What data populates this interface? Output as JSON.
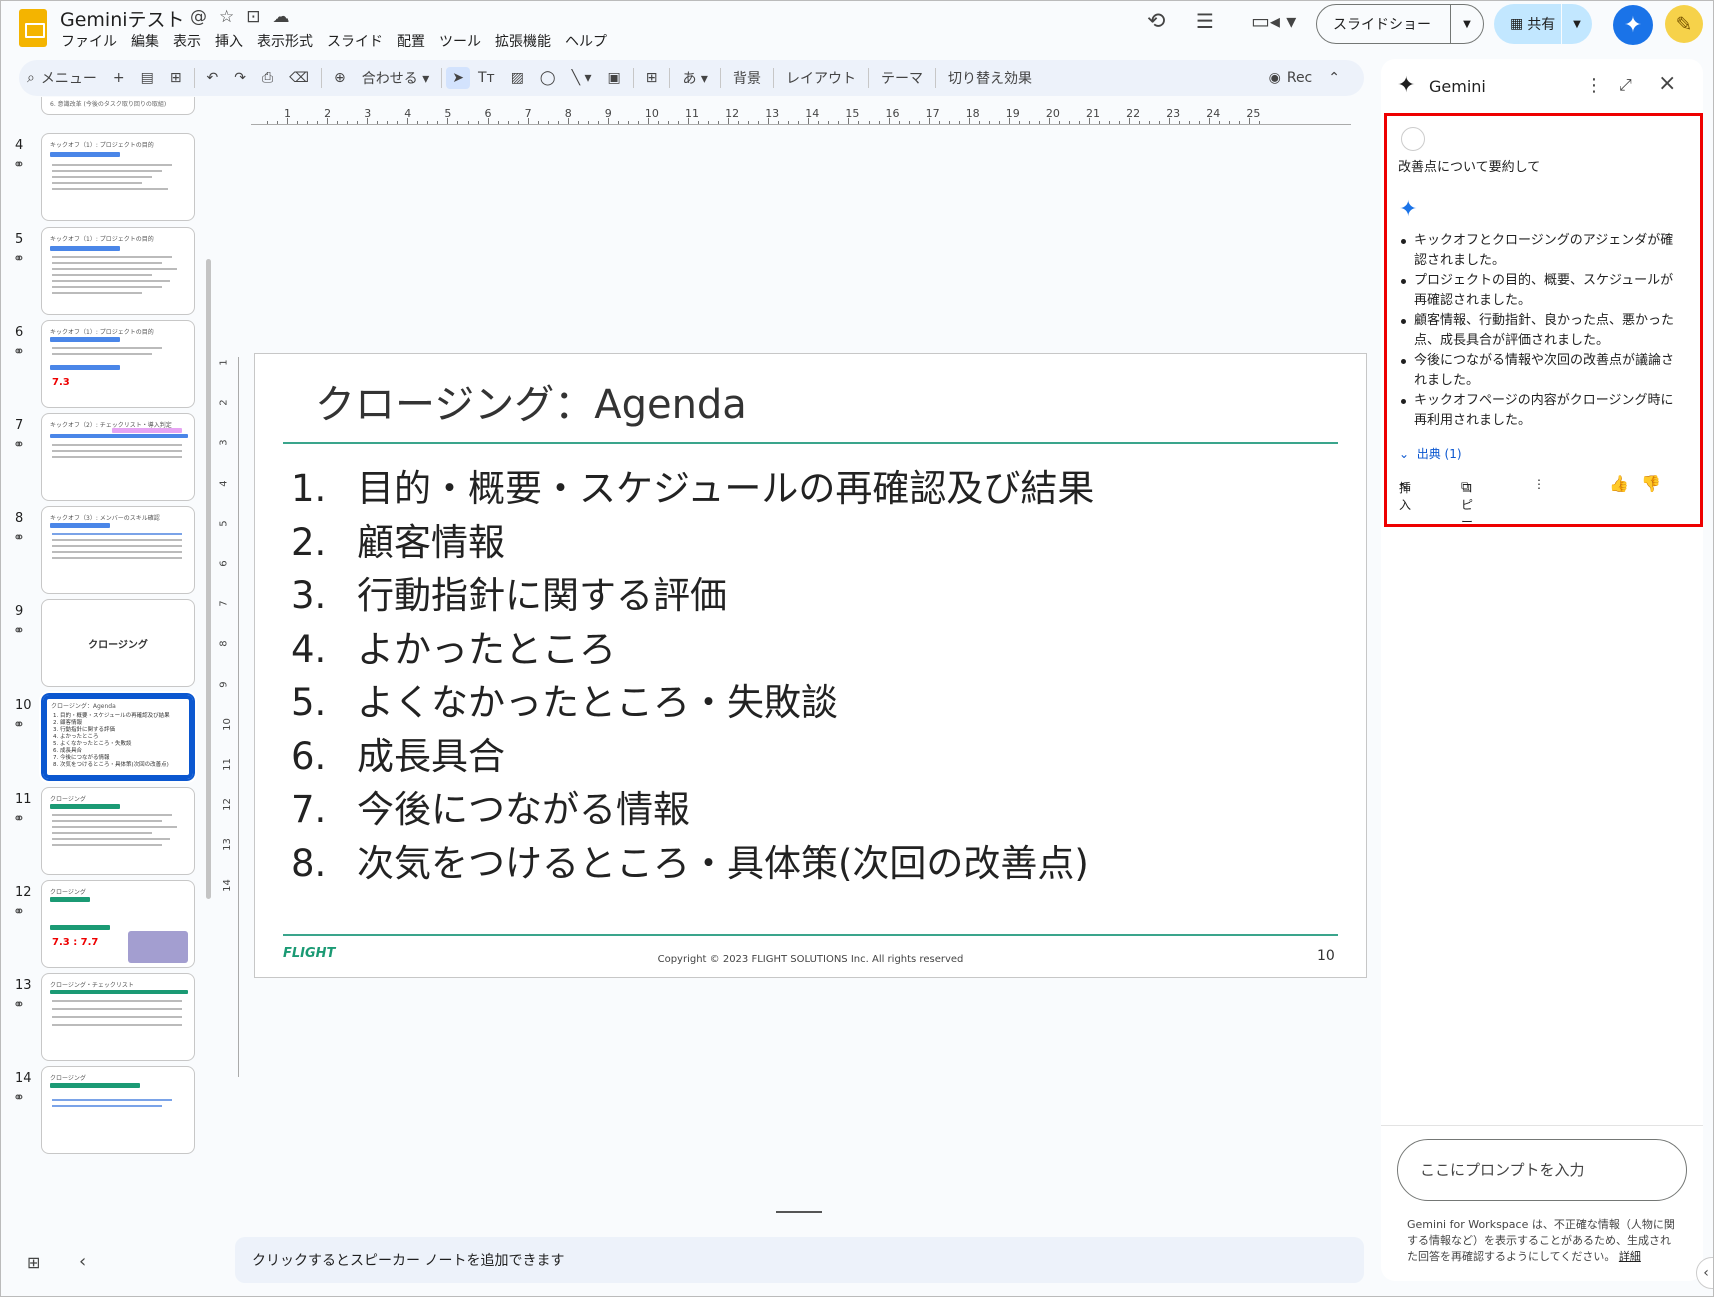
{
  "app": {
    "doc_title": "Geminiテスト",
    "menu": [
      "ファイル",
      "編集",
      "表示",
      "挿入",
      "表示形式",
      "スライド",
      "配置",
      "ツール",
      "拡張機能",
      "ヘルプ"
    ],
    "slideshow_label": "スライドショー",
    "share_label": "共有"
  },
  "toolbar": {
    "menu_label": "メニュー",
    "zoom_label": "合わせる",
    "input_label": "あ",
    "background": "背景",
    "layout": "レイアウト",
    "theme": "テーマ",
    "transition": "切り替え効果",
    "rec": "Rec"
  },
  "filmstrip": {
    "top_snippet": "6. 意識改革 (今後のタスク取り回りの取組)",
    "slides": [
      {
        "num": "4",
        "title": "キックオフ（1）: プロジェクトの目的"
      },
      {
        "num": "5",
        "title": "キックオフ（1）: プロジェクトの目的"
      },
      {
        "num": "6",
        "title": "キックオフ（1）: プロジェクトの目的",
        "figure": "7.3"
      },
      {
        "num": "7",
        "title": "キックオフ（2）: チェックリスト・導入判定"
      },
      {
        "num": "8",
        "title": "キックオフ（3）: メンバーのスキル確認"
      },
      {
        "num": "9",
        "title": "クロージング"
      },
      {
        "num": "10",
        "title": "クロージング：Agenda"
      },
      {
        "num": "11",
        "title": "クロージング"
      },
      {
        "num": "12",
        "title": "クロージング",
        "figure": "7.3 : 7.7"
      },
      {
        "num": "13",
        "title": "クロージング・チェックリスト"
      },
      {
        "num": "14",
        "title": "クロージング"
      }
    ]
  },
  "ruler": {
    "h": [
      "1",
      "2",
      "3",
      "4",
      "5",
      "6",
      "7",
      "8",
      "9",
      "10",
      "11",
      "12",
      "13",
      "14",
      "15",
      "16",
      "17",
      "18",
      "19",
      "20",
      "21",
      "22",
      "23",
      "24",
      "25"
    ],
    "v": [
      "1",
      "2",
      "3",
      "4",
      "5",
      "6",
      "7",
      "8",
      "9",
      "10",
      "11",
      "12",
      "13",
      "14"
    ]
  },
  "slide": {
    "title": "クロージング：Agenda",
    "items": [
      {
        "n": "1.",
        "text": "目的・概要・スケジュールの再確認及び結果"
      },
      {
        "n": "2.",
        "text": "顧客情報"
      },
      {
        "n": "3.",
        "text": "行動指針に関する評価"
      },
      {
        "n": "4.",
        "text": "よかったところ"
      },
      {
        "n": "5.",
        "text": "よくなかったところ・失敗談"
      },
      {
        "n": "6.",
        "text": "成長具合"
      },
      {
        "n": "7.",
        "text": "今後につながる情報"
      },
      {
        "n": "8.",
        "text": "次気をつけるところ・具体策(次回の改善点)"
      }
    ],
    "logo": "FLIGHT",
    "copyright": "Copyright ©  2023 FLIGHT SOLUTIONS Inc. All rights reserved",
    "page": "10"
  },
  "notes_placeholder": "クリックするとスピーカー ノートを追加できます",
  "gemini": {
    "title": "Gemini",
    "prompt": "改善点について要約して",
    "bullets": [
      "キックオフとクロージングのアジェンダが確認されました。",
      "プロジェクトの目的、概要、スケジュールが再確認されました。",
      "顧客情報、行動指針、良かった点、悪かった点、成長具合が評価されました。",
      "今後につながる情報や次回の改善点が議論されました。",
      "キックオフページの内容がクロージング時に再利用されました。"
    ],
    "sources": "出典 (1)",
    "insert": "挿入",
    "copy": "コピー",
    "input_placeholder": "ここにプロンプトを入力",
    "disclaimer": "Gemini for Workspace は、不正確な情報（人物に関する情報など）を表示することがあるため、生成された回答を再確認するようにしてください。",
    "details": "詳細"
  },
  "colors": {
    "accent": "#0b57d0",
    "slide_rule": "#3aa58c",
    "highlight": "#e00000",
    "gemini_blue": "#1a73e8"
  }
}
